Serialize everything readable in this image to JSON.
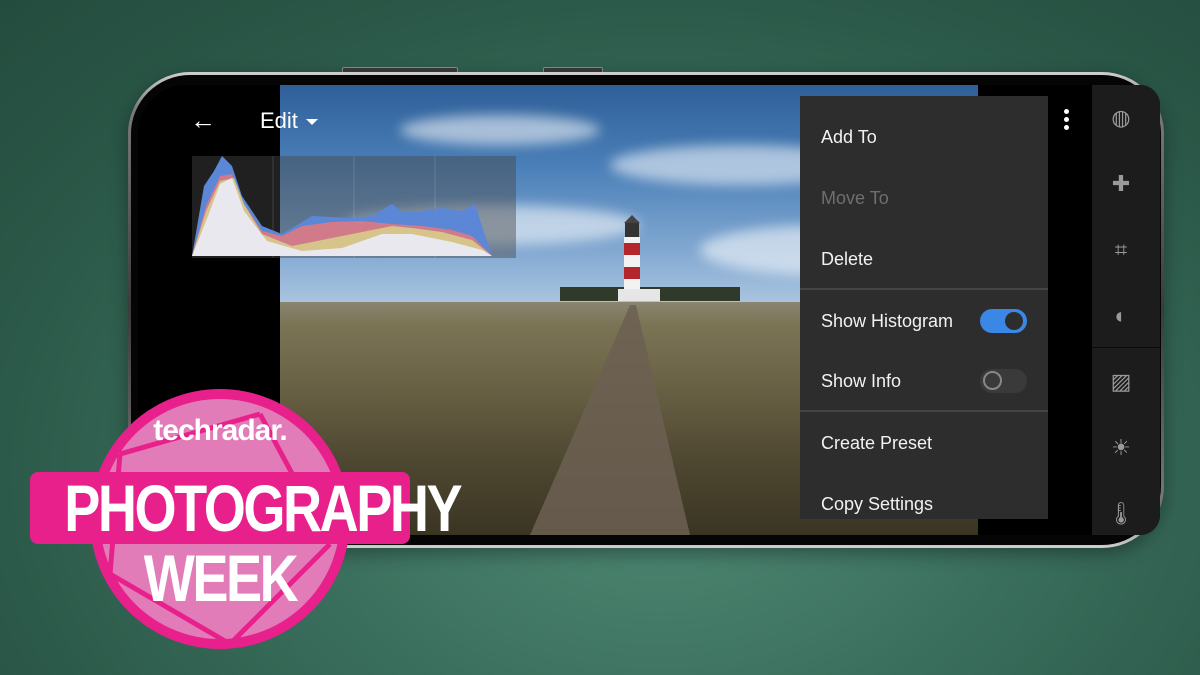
{
  "app": {
    "header": {
      "back_label": "←",
      "mode_label": "Edit"
    },
    "menu": {
      "items": [
        {
          "label": "Add To",
          "enabled": true
        },
        {
          "label": "Move To",
          "enabled": false
        },
        {
          "label": "Delete",
          "enabled": true
        },
        {
          "label": "Show Histogram",
          "toggle": true,
          "on": true
        },
        {
          "label": "Show Info",
          "toggle": true,
          "on": false
        },
        {
          "label": "Create Preset",
          "enabled": true
        },
        {
          "label": "Copy Settings",
          "enabled": true
        }
      ]
    },
    "tools": [
      {
        "name": "selective-icon",
        "glyph": "◍"
      },
      {
        "name": "healing-icon",
        "glyph": "✚"
      },
      {
        "name": "crop-icon",
        "glyph": "⌗"
      },
      {
        "name": "masking-icon",
        "glyph": "◐"
      },
      {
        "name": "auto-icon",
        "glyph": "▨"
      },
      {
        "name": "light-icon",
        "glyph": "☀"
      },
      {
        "name": "color-temperature-icon",
        "glyph": "🌡"
      }
    ],
    "colors": {
      "accent": "#3a87e6",
      "menu_bg": "#2d2d2d",
      "badge_pink": "#e8208c"
    }
  },
  "badge": {
    "brand": "techradar.",
    "line1": "PHOTOGRAPHY",
    "line2": "WEEK"
  }
}
